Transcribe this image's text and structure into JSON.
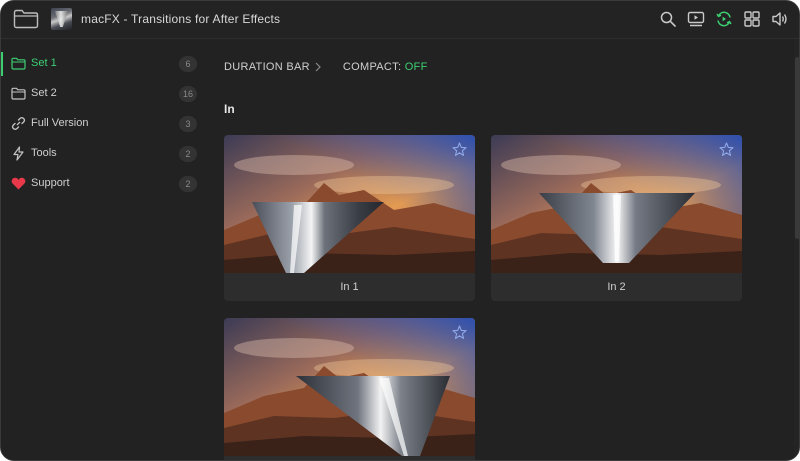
{
  "app": {
    "title": "macFX - Transitions for After Effects"
  },
  "titlebar_icons": [
    "search-icon",
    "preview-icon",
    "sync-icon",
    "grid-view-icon",
    "volume-icon"
  ],
  "sidebar": {
    "items": [
      {
        "label": "Set 1",
        "count": "6",
        "icon": "folder-icon",
        "active": true
      },
      {
        "label": "Set 2",
        "count": "16",
        "icon": "folder-icon",
        "active": false
      },
      {
        "label": "Full Version",
        "count": "3",
        "icon": "link-icon",
        "active": false
      },
      {
        "label": "Tools",
        "count": "2",
        "icon": "lightning-icon",
        "active": false
      },
      {
        "label": "Support",
        "count": "2",
        "icon": "heart-icon",
        "active": false
      }
    ]
  },
  "toolbar": {
    "duration_label": "DURATION BAR",
    "compact_label": "COMPACT: ",
    "compact_value": "OFF"
  },
  "section": {
    "title": "In"
  },
  "cards": [
    {
      "label": "In 1"
    },
    {
      "label": "In 2"
    },
    {
      "label": ""
    }
  ],
  "colors": {
    "accent": "#3ccf72",
    "background": "#222222",
    "card": "#2d2d2d",
    "heart": "#e8394a",
    "star": "#8fa8e8"
  }
}
